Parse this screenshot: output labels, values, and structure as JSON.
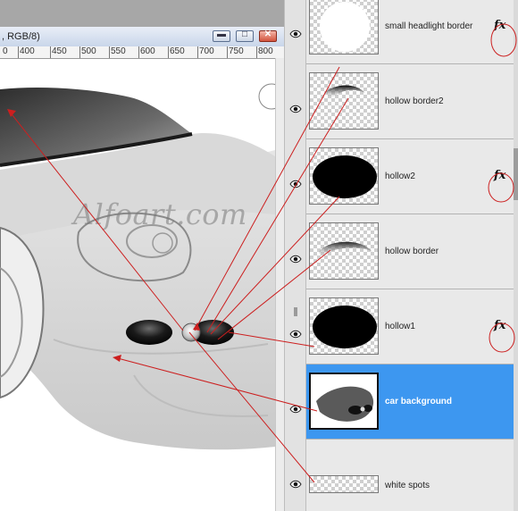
{
  "document": {
    "title": ", RGB/8)",
    "ruler_labels": [
      "0",
      "400",
      "450",
      "500",
      "550",
      "600",
      "650",
      "700",
      "750",
      "800"
    ],
    "window_buttons": {
      "minimize": "▬",
      "maximize": "□",
      "close": "✕"
    }
  },
  "watermark": "Alfoart.com",
  "layers": [
    {
      "name": "small headlight border",
      "fx": "fx",
      "selected": false
    },
    {
      "name": "hollow border2",
      "fx": "",
      "selected": false
    },
    {
      "name": "hollow2",
      "fx": "fx",
      "selected": false
    },
    {
      "name": "hollow border",
      "fx": "",
      "selected": false
    },
    {
      "name": "hollow1",
      "fx": "fx",
      "selected": false
    },
    {
      "name": "car background",
      "fx": "",
      "selected": true
    },
    {
      "name": "white spots",
      "fx": "",
      "selected": false
    }
  ],
  "icons": {
    "visibility": "eye-icon",
    "effects": "fx-icon",
    "panel_grip": "grip-icon"
  },
  "colors": {
    "selection": "#3d97f0",
    "annotation": "#cc1f1f"
  }
}
